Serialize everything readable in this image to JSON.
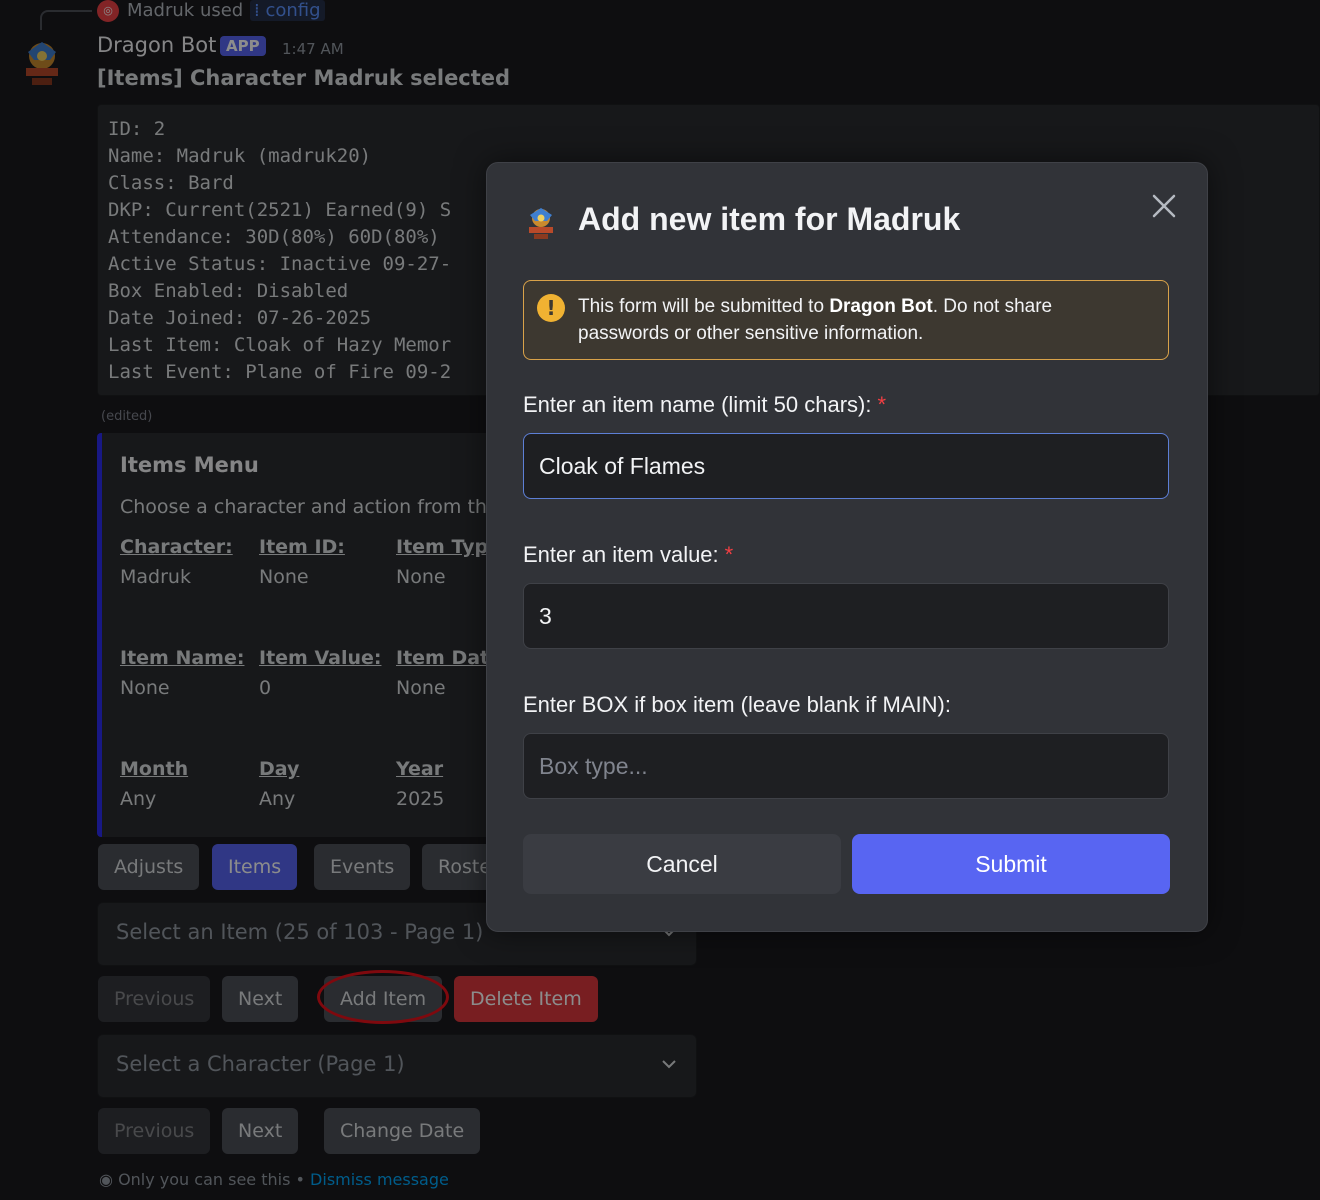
{
  "reply": {
    "user": "Madruk used",
    "command": "config"
  },
  "message": {
    "author": "Dragon Bot",
    "tag": "APP",
    "time": "1:47 AM",
    "title": "[Items] Character Madruk selected",
    "code_lines": [
      "ID: 2",
      "Name: Madruk (madruk20)",
      "Class: Bard",
      "DKP: Current(2521) Earned(9) S",
      "Attendance: 30D(80%) 60D(80%)",
      "Active Status: Inactive 09-27-",
      "Box Enabled: Disabled",
      "Date Joined: 07-26-2025",
      "Last Item: Cloak of Hazy Memor",
      "Last Event: Plane of Fire 09-2"
    ],
    "edited": "(edited)"
  },
  "embed": {
    "title": "Items Menu",
    "description": "Choose a character and action from the l",
    "fields": [
      {
        "name": "Character:",
        "value": "Madruk"
      },
      {
        "name": "Item ID:",
        "value": "None"
      },
      {
        "name": "Item Type",
        "value": "None"
      },
      {
        "name": "Item Name:",
        "value": "None"
      },
      {
        "name": "Item Value:",
        "value": "0"
      },
      {
        "name": "Item Date",
        "value": "None"
      },
      {
        "name": "Month",
        "value": "Any"
      },
      {
        "name": "Day",
        "value": "Any"
      },
      {
        "name": "Year",
        "value": "2025"
      }
    ]
  },
  "tabs": [
    "Adjusts",
    "Items",
    "Events",
    "Roste"
  ],
  "item_select": {
    "placeholder": "Select an Item (25 of 103 - Page 1)"
  },
  "item_buttons": {
    "previous": "Previous",
    "next": "Next",
    "add": "Add Item",
    "delete": "Delete Item"
  },
  "char_select": {
    "placeholder": "Select a Character (Page 1)"
  },
  "char_buttons": {
    "previous": "Previous",
    "next": "Next",
    "change_date": "Change Date"
  },
  "ephemeral": {
    "text": "Only you can see this",
    "sep": "•",
    "link": "Dismiss message"
  },
  "modal": {
    "title": "Add new item for Madruk",
    "warning_pre": "This form will be submitted to ",
    "warning_bold": "Dragon Bot",
    "warning_post": ". Do not share passwords or other sensitive information.",
    "warning_icon": "!",
    "field1_label": "Enter an item name (limit 50 chars):",
    "field1_value": "Cloak of Flames",
    "field2_label": "Enter an item value:",
    "field2_value": "3",
    "field3_label": "Enter BOX if box item (leave blank if MAIN):",
    "field3_placeholder": "Box type...",
    "required_mark": "*",
    "cancel": "Cancel",
    "submit": "Submit"
  },
  "colors": {
    "blurple": "#5865f2",
    "danger": "#da373c",
    "warning": "#f0b232",
    "embed_bar": "#2d2df0",
    "highlight_circle": "#e8111b"
  }
}
